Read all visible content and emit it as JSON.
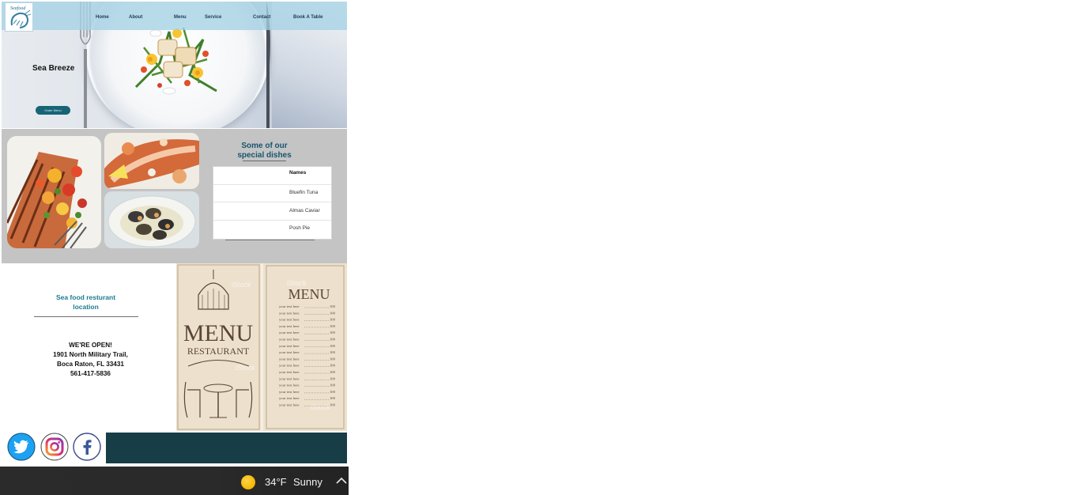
{
  "hero": {
    "title": "Sea Breeze",
    "order_button": "Order Menu"
  },
  "nav": {
    "items": [
      "Home",
      "About",
      "Menu",
      "Service",
      "Contact",
      "Book  A Table"
    ],
    "logo_text": "Seafood"
  },
  "dishes": {
    "title_line1": "Some of our",
    "title_line2": "special dishes",
    "table": {
      "header": "Names",
      "rows": [
        "Bluefin Tuna",
        "Almas Caviar",
        "Posh Pie"
      ]
    }
  },
  "location": {
    "title_line1": "Sea food resturant",
    "title_line2": "location",
    "open_label": "WE'RE OPEN!",
    "address_line1": "1901 North Military Trail,",
    "address_line2": "Boca Raton, FL 33431",
    "phone": "561-417-5836"
  },
  "menu_images": {
    "left_big_word": "MENU",
    "left_sub_word": "RESTAURANT",
    "right_title": "MENU",
    "watermark": "iStock",
    "item_text": "your text here",
    "item_price": "100"
  },
  "social": {
    "icons": [
      "twitter-icon",
      "instagram-icon",
      "facebook-icon"
    ]
  },
  "taskbar": {
    "temperature": "34°F",
    "condition": "Sunny"
  },
  "colors": {
    "accent": "#176477",
    "footer_band": "#173d47",
    "dishes_bg": "#c4c4c4",
    "nav_bg": "#a5d2e4"
  }
}
